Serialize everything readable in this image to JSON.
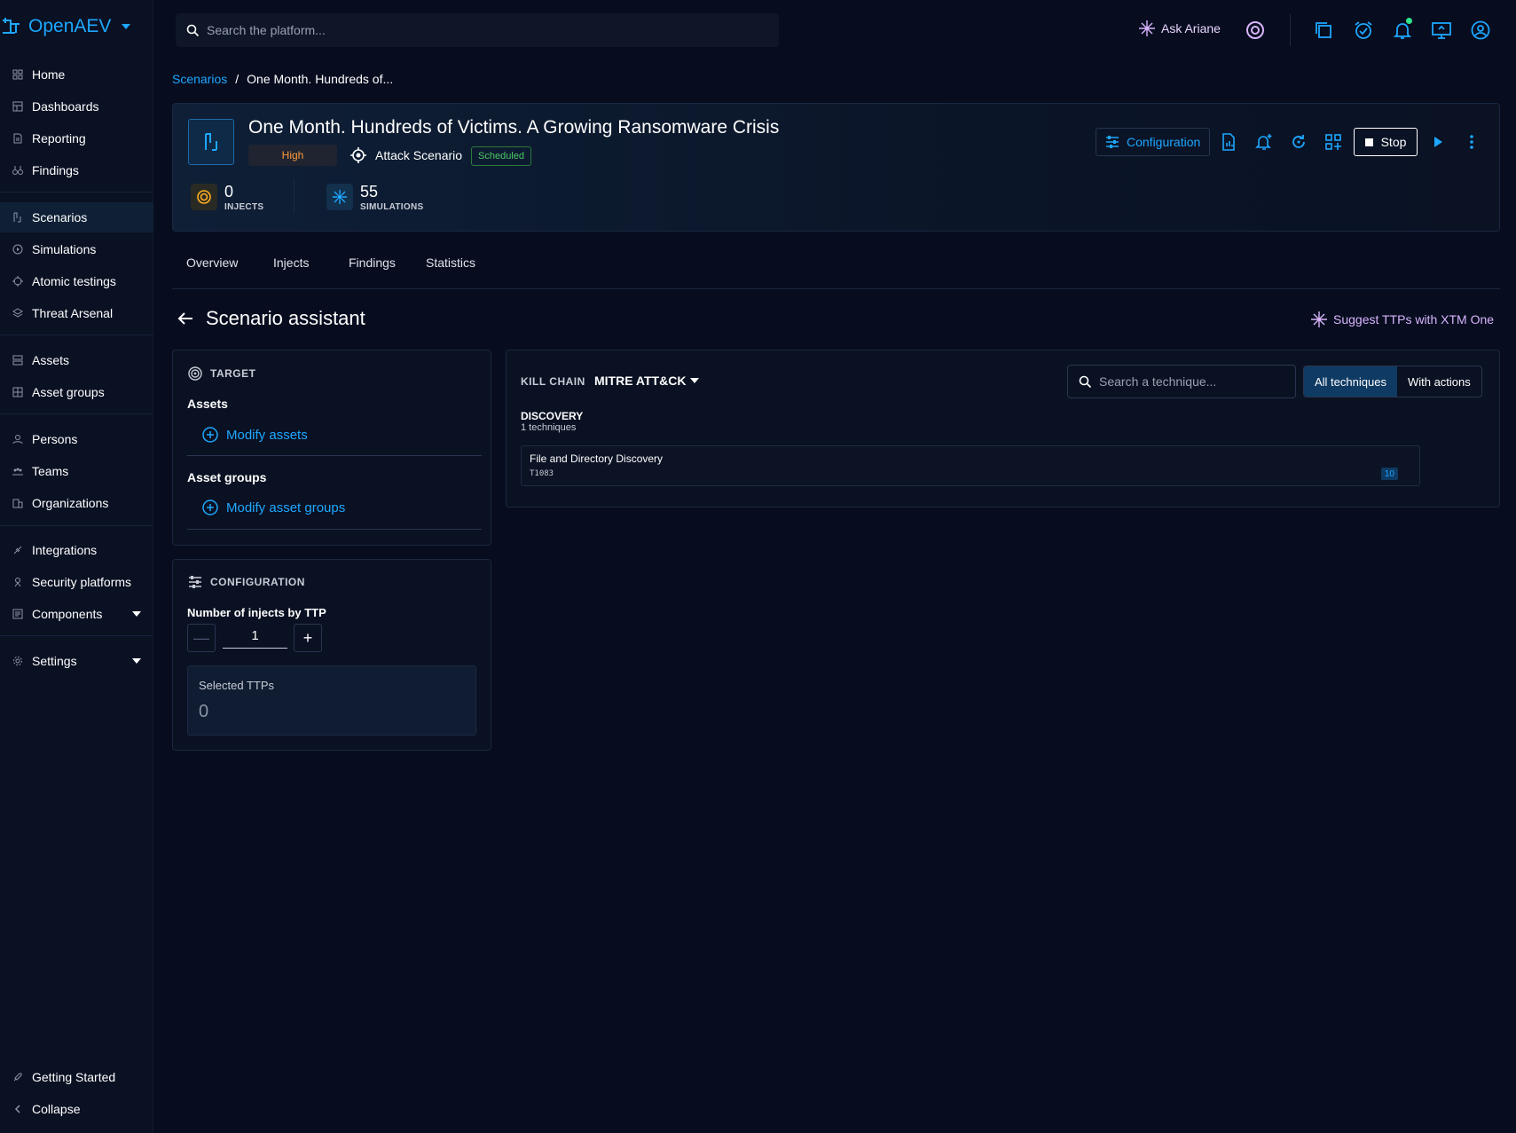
{
  "app": {
    "name": "OpenAEV"
  },
  "search": {
    "placeholder": "Search the platform..."
  },
  "topbar": {
    "ask_label": "Ask Ariane"
  },
  "sidebar": {
    "items": [
      {
        "label": "Home"
      },
      {
        "label": "Dashboards"
      },
      {
        "label": "Reporting"
      },
      {
        "label": "Findings"
      },
      {
        "label": "Scenarios"
      },
      {
        "label": "Simulations"
      },
      {
        "label": "Atomic testings"
      },
      {
        "label": "Threat Arsenal"
      },
      {
        "label": "Assets"
      },
      {
        "label": "Asset groups"
      },
      {
        "label": "Persons"
      },
      {
        "label": "Teams"
      },
      {
        "label": "Organizations"
      },
      {
        "label": "Integrations"
      },
      {
        "label": "Security platforms"
      },
      {
        "label": "Components"
      },
      {
        "label": "Settings"
      },
      {
        "label": "Getting Started"
      },
      {
        "label": "Collapse"
      }
    ]
  },
  "breadcrumb": {
    "root": "Scenarios",
    "separator": "/",
    "current": "One Month. Hundreds of..."
  },
  "scenario": {
    "title": "One Month. Hundreds of Victims. A Growing Ransomware Crisis",
    "severity": "High",
    "type": "Attack Scenario",
    "status": "Scheduled",
    "injects_count": "0",
    "injects_label": "INJECTS",
    "simulations_count": "55",
    "simulations_label": "SIMULATIONS",
    "config_label": "Configuration",
    "stop_label": "Stop"
  },
  "tabs": [
    {
      "label": "Overview"
    },
    {
      "label": "Injects"
    },
    {
      "label": "Findings"
    },
    {
      "label": "Statistics"
    }
  ],
  "assistant": {
    "title": "Scenario assistant",
    "suggest_label": "Suggest TTPs with XTM One"
  },
  "target": {
    "heading": "TARGET",
    "assets_label": "Assets",
    "modify_assets": "Modify assets",
    "asset_groups_label": "Asset groups",
    "modify_asset_groups": "Modify asset groups"
  },
  "configuration": {
    "heading": "CONFIGURATION",
    "injects_by_ttp_label": "Number of injects by TTP",
    "injects_by_ttp_value": "1",
    "minus": "—",
    "plus": "+",
    "selected_ttps_label": "Selected TTPs",
    "selected_ttps_value": "0"
  },
  "kill_chain": {
    "label": "KILL CHAIN",
    "framework": "MITRE ATT&CK",
    "search_placeholder": "Search a technique...",
    "filter_all": "All techniques",
    "filter_actions": "With actions",
    "phases": [
      {
        "name": "DISCOVERY",
        "count_label": "1 techniques",
        "techniques": [
          {
            "name": "File and Directory Discovery",
            "id": "T1083",
            "count": "10"
          }
        ]
      }
    ]
  },
  "colors": {
    "accent": "#1ea7ff",
    "background": "#070d1f",
    "severity_high": "#ff9a3c",
    "status_scheduled": "#4cc764",
    "ai": "#d8b4fe"
  }
}
